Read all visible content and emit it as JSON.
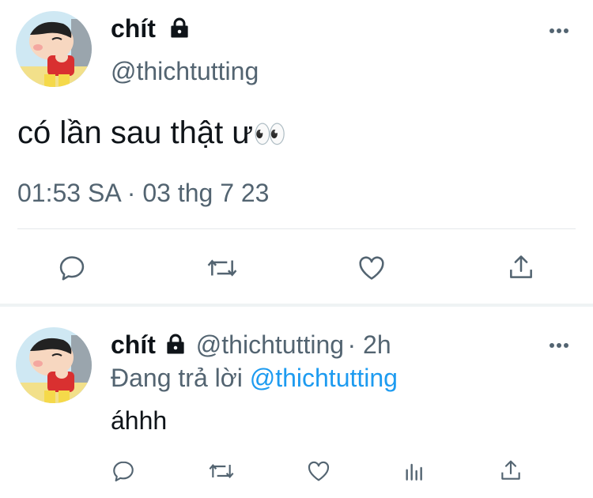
{
  "main_tweet": {
    "author_name": "chít",
    "author_handle": "@thichtutting",
    "avatar_icon": "cartoon-avatar-icon",
    "lock_icon": "lock-icon",
    "text": "có lần sau thật ư",
    "emoji": "👀",
    "timestamp": "01:53 SA · 03 thg 7 23",
    "actions": [
      "reply-icon",
      "retweet-icon",
      "like-icon",
      "share-icon"
    ]
  },
  "reply_tweet": {
    "author_name": "chít",
    "author_handle": "@thichtutting",
    "time": "· 2h",
    "replying_prefix": "Đang trả lời",
    "replying_to": "@thichtutting",
    "text": "áhhh",
    "actions": [
      "reply-icon",
      "retweet-icon",
      "like-icon",
      "analytics-icon",
      "share-icon"
    ]
  },
  "colors": {
    "text": "#0f1419",
    "secondary": "#536471",
    "link": "#1d9bf0",
    "divider": "#e5e8eb"
  }
}
